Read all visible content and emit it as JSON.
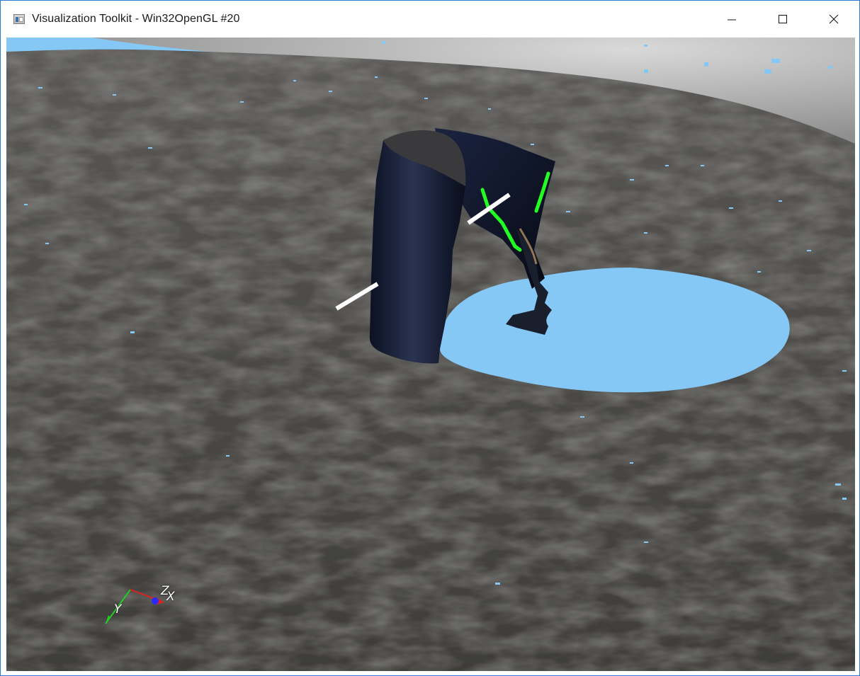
{
  "window": {
    "title": "Visualization Toolkit - Win32OpenGL #20",
    "controls": [
      "minimize",
      "maximize",
      "close"
    ]
  },
  "icons": {
    "app": "vtk-window-icon",
    "minimize": "minimize-icon",
    "maximize": "maximize-icon",
    "close": "close-icon"
  },
  "viewport": {
    "background_color": "#85c8f5",
    "surface_color": "#4b4a47",
    "hole_color": "#85c8f5",
    "cylinder_color": "#14192e",
    "contour_color": "#22ff22",
    "line_color": "#ffffff"
  },
  "orientation_axes": {
    "x_label": "X",
    "y_label": "Y",
    "z_label": "Z",
    "x_color": "#e02020",
    "y_color": "#22cc22",
    "z_color": "#2a2aff"
  }
}
